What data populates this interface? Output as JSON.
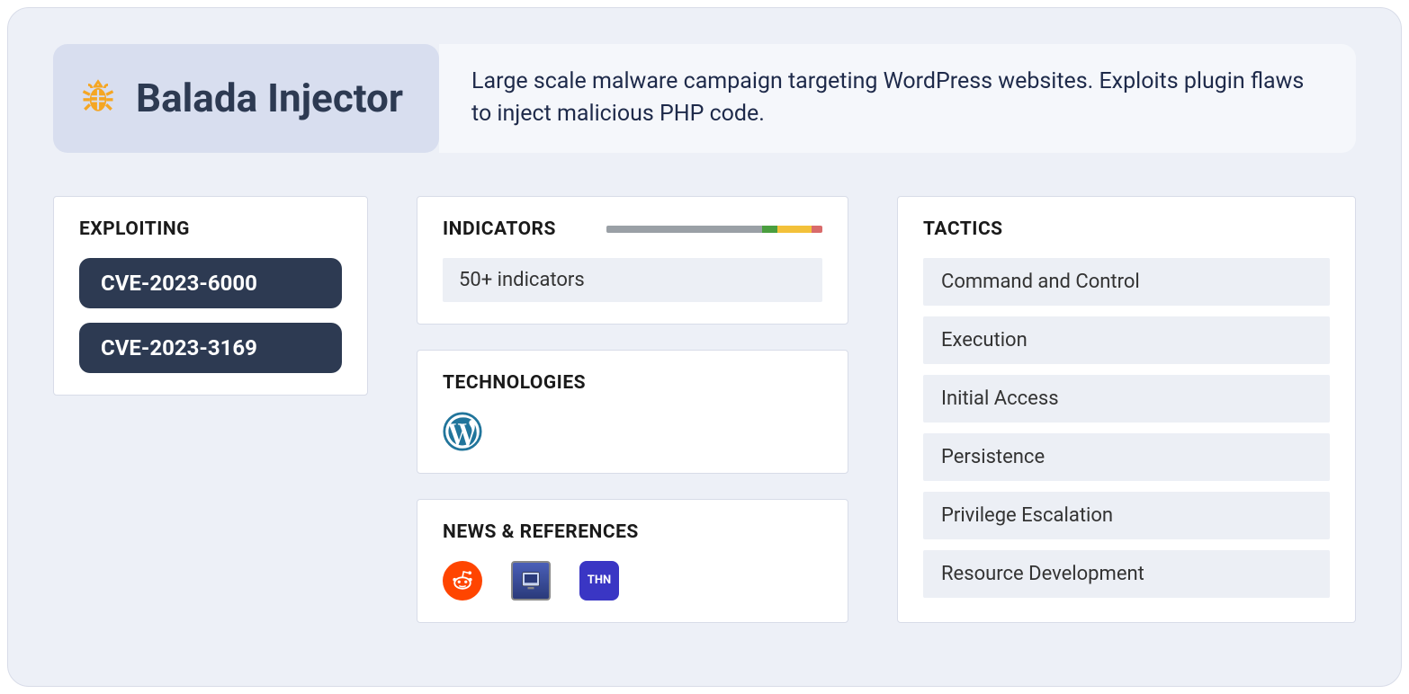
{
  "header": {
    "title": "Balada Injector",
    "description": "Large scale malware campaign targeting WordPress websites. Exploits plugin flaws to inject malicious PHP code."
  },
  "exploiting": {
    "title": "EXPLOITING",
    "cves": [
      "CVE-2023-6000",
      "CVE-2023-3169"
    ]
  },
  "indicators": {
    "title": "INDICATORS",
    "summary": "50+ indicators",
    "bar_segments": [
      {
        "color": "#9aa0a6",
        "width": 72
      },
      {
        "color": "#4a9e3f",
        "width": 7
      },
      {
        "color": "#f3c13a",
        "width": 16
      },
      {
        "color": "#d96b6b",
        "width": 5
      }
    ]
  },
  "technologies": {
    "title": "TECHNOLOGIES",
    "items": [
      "wordpress"
    ]
  },
  "news": {
    "title": "NEWS & REFERENCES",
    "sources": [
      {
        "name": "reddit",
        "label": ""
      },
      {
        "name": "bleepingcomputer",
        "label": ""
      },
      {
        "name": "thehackernews",
        "label": "THN"
      }
    ]
  },
  "tactics": {
    "title": "TACTICS",
    "items": [
      "Command and Control",
      "Execution",
      "Initial Access",
      "Persistence",
      "Privilege Escalation",
      "Resource Development"
    ]
  }
}
